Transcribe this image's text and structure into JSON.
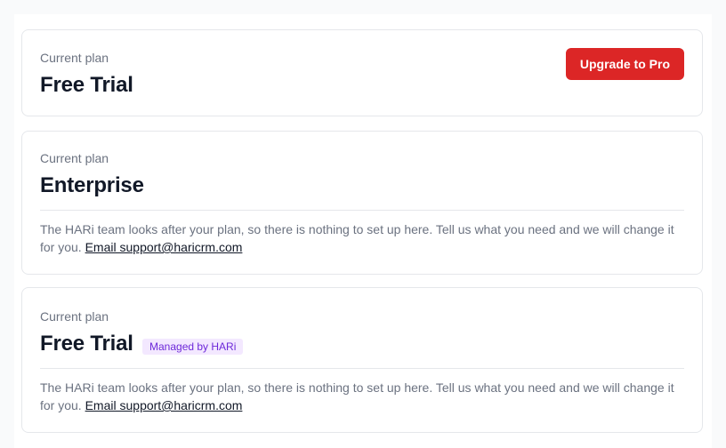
{
  "cards": [
    {
      "eyebrow": "Current plan",
      "plan": "Free Trial",
      "action_label": "Upgrade to Pro"
    },
    {
      "eyebrow": "Current plan",
      "plan": "Enterprise",
      "note": "The HARi team looks after your plan, so there is nothing to set up here. Tell us what you need and we will change it for you.",
      "link_label": "Email support@haricrm.com"
    },
    {
      "eyebrow": "Current plan",
      "plan": "Free Trial",
      "badge": "Managed by HARi",
      "note": "The HARi team looks after your plan, so there is nothing to set up here. Tell us what you need and we will change it for you.",
      "link_label": "Email support@haricrm.com"
    }
  ],
  "colors": {
    "accent": "#dc2626",
    "badge_bg": "#f3e8ff",
    "badge_text": "#6d28d9"
  }
}
